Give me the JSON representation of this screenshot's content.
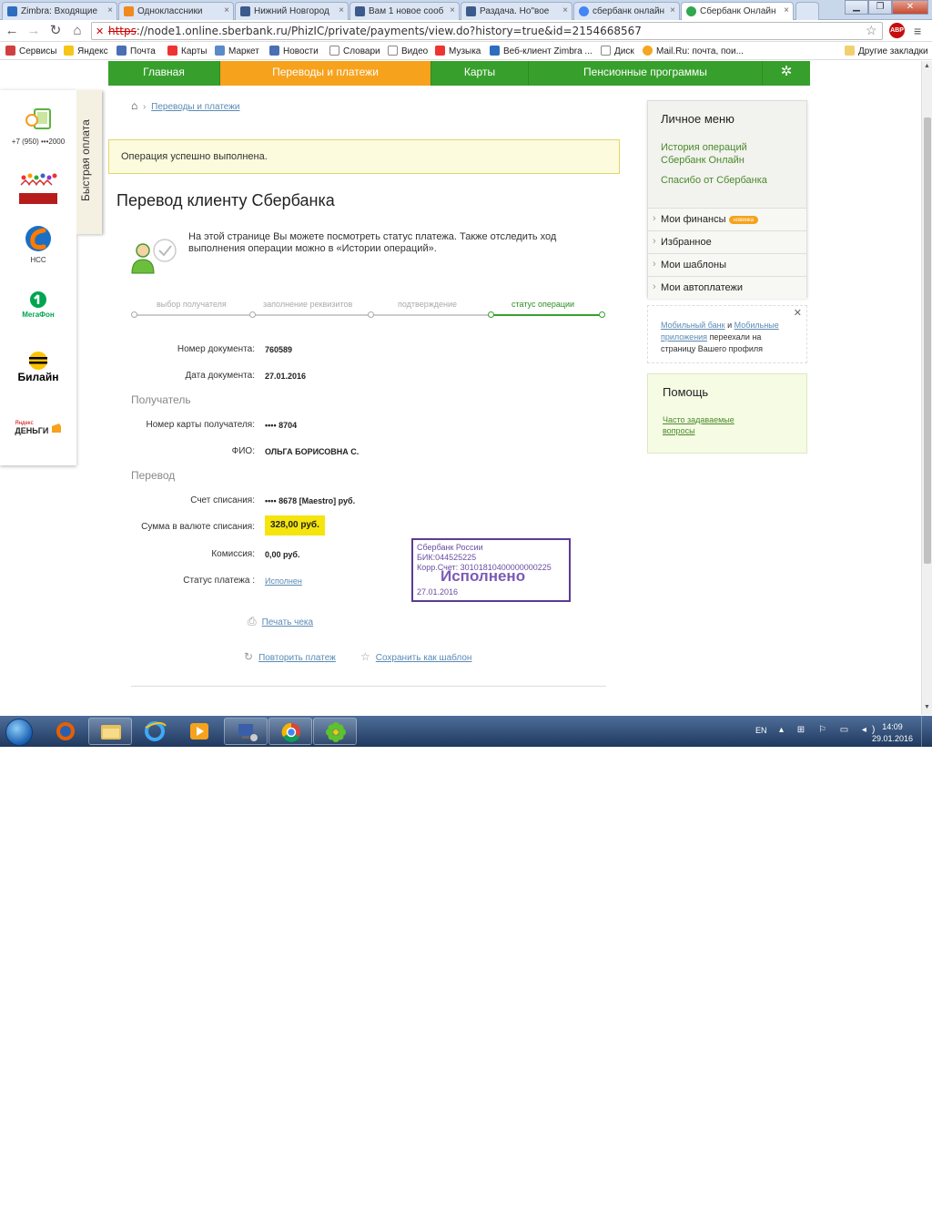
{
  "browser": {
    "tabs": [
      {
        "label": "Zimbra: Входящие",
        "color": "#2f6dbf"
      },
      {
        "label": "Одноклассники",
        "color": "#f08a1d"
      },
      {
        "label": "Нижний Новгород",
        "color": "#3c5a8c"
      },
      {
        "label": "Вам 1 новое сооб",
        "color": "#3c5a8c"
      },
      {
        "label": "Раздача. Но\"вое",
        "color": "#3c5a8c"
      },
      {
        "label": "сбербанк онлайн",
        "color": "#4285f4"
      },
      {
        "label": "Сбербанк Онлайн",
        "color": "#2fa84f"
      }
    ],
    "url": {
      "scheme": "https",
      "rest": "://node1.online.sberbank.ru/PhizIC/private/payments/view.do?history=true&id=2154668567"
    },
    "abp": "ABP",
    "bookmarks": [
      "Сервисы",
      "Яндекс",
      "Почта",
      "Карты",
      "Маркет",
      "Новости",
      "Словари",
      "Видео",
      "Музыка",
      "Веб-клиент Zimbra ...",
      "Диск",
      "Mail.Ru: почта, пои..."
    ],
    "bookmarks_right": "Другие закладки"
  },
  "nav": {
    "items": [
      "Главная",
      "Переводы и платежи",
      "Карты",
      "Пенсионные программы"
    ],
    "gear": "✲"
  },
  "quickpay": {
    "tab_label": "Быстрая оплата",
    "phone": "+7 (950) •••2000",
    "nss": "НСС",
    "megafon": "МегаФон",
    "beeline": "Билайн",
    "yandex_top": "Яндекс",
    "yandex_bottom": "ДЕНЬГИ"
  },
  "breadcrumb": {
    "link": "Переводы и платежи"
  },
  "success_message": "Операция успешно выполнена.",
  "title": "Перевод клиенту Сбербанка",
  "info": "На этой странице Вы можете посмотреть статус платежа. Также отследить ход выполнения операции можно в «Истории операций».",
  "steps": [
    "выбор получателя",
    "заполнение реквизитов",
    "подтверждение",
    "статус операции"
  ],
  "doc": {
    "number_label": "Номер документа:",
    "number": "760589",
    "date_label": "Дата документа:",
    "date": "27.01.2016"
  },
  "recipient": {
    "section": "Получатель",
    "card_label": "Номер карты получателя:",
    "card": "•••• 8704",
    "name_label": "ФИО:",
    "name": "ОЛЬГА БОРИСОВНА С."
  },
  "transfer": {
    "section": "Перевод",
    "account_label": "Счет списания:",
    "account": "•••• 8678  [Maestro]  руб.",
    "amount_label": "Сумма в валюте списания:",
    "amount": "328,00  руб.",
    "fee_label": "Комиссия:",
    "fee": "0,00 руб.",
    "status_label": "Статус платежа :",
    "status": "Исполнен"
  },
  "stamp": {
    "bank": "Сбербанк России",
    "bik": "БИК:044525225",
    "account": "Корр.Счет: 30101810400000000225",
    "text": "Исполнено",
    "date": "27.01.2016"
  },
  "actions": {
    "print": "Печать чека",
    "repeat": "Повторить платеж",
    "save": "Сохранить как шаблон"
  },
  "personal_menu": {
    "title": "Личное меню",
    "links": [
      "История операций Сбербанк Онлайн",
      "Спасибо от Сбербанка"
    ],
    "items": [
      "Мои финансы",
      "Избранное",
      "Мои шаблоны",
      "Мои автоплатежи"
    ],
    "new_badge": "новинка"
  },
  "notice": {
    "link1": "Мобильный банк",
    "and": " и ",
    "link2": "Мобильные приложения",
    "text": " переехали на страницу Вашего профиля"
  },
  "help": {
    "title": "Помощь",
    "link": "Часто задаваемые вопросы"
  },
  "taskbar": {
    "lang": "EN",
    "time": "14:09",
    "date": "29.01.2016"
  }
}
